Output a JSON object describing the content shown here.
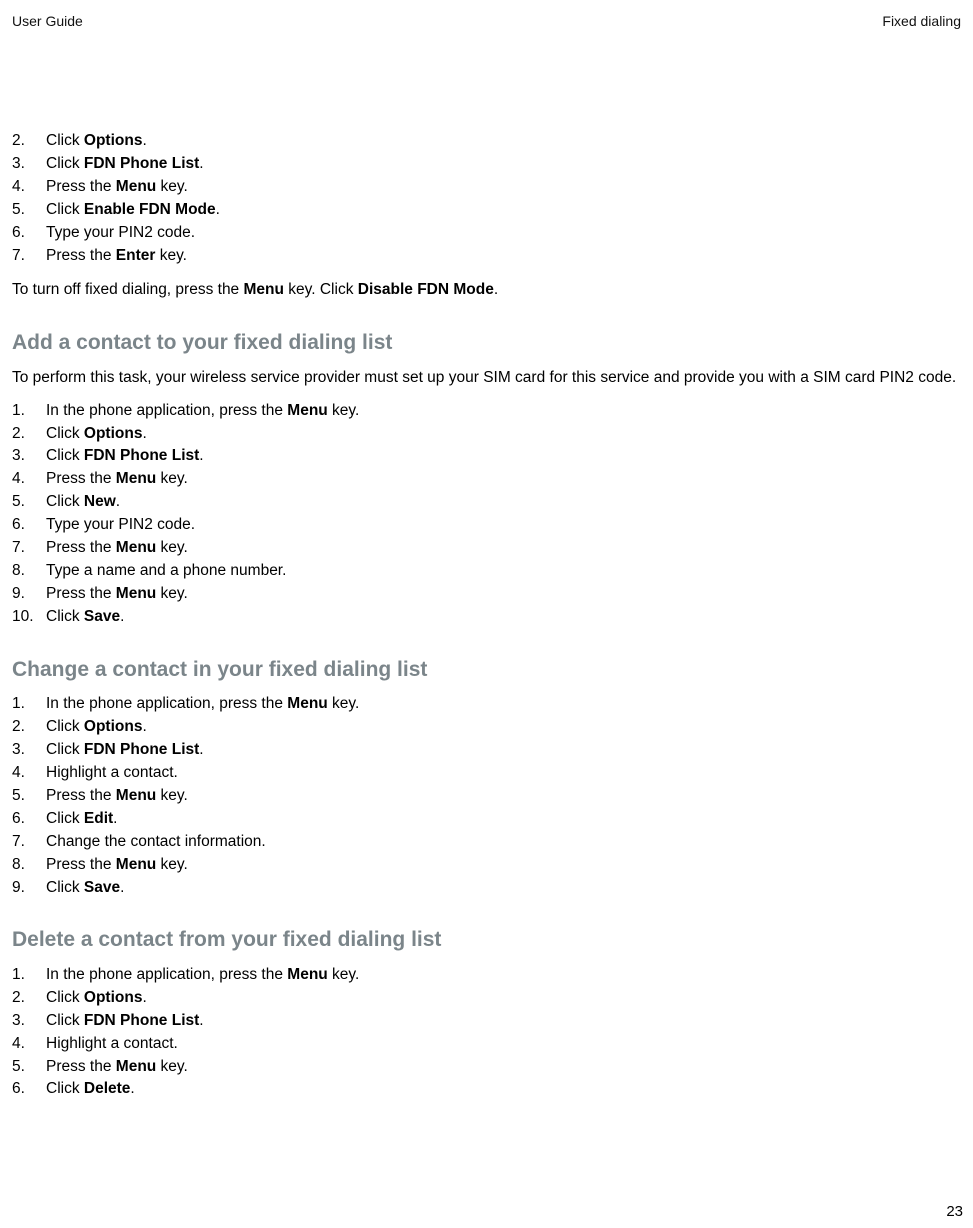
{
  "header": {
    "left": "User Guide",
    "right": "Fixed dialing"
  },
  "page_number": "23",
  "section_top": {
    "steps": [
      {
        "pre": "Click ",
        "bold": "Options",
        "post": "."
      },
      {
        "pre": "Click ",
        "bold": "FDN Phone List",
        "post": "."
      },
      {
        "pre": "Press the ",
        "bold": "Menu",
        "post": " key."
      },
      {
        "pre": "Click ",
        "bold": "Enable FDN Mode",
        "post": "."
      },
      {
        "pre": "Type your PIN2 code.",
        "bold": "",
        "post": ""
      },
      {
        "pre": "Press the ",
        "bold": "Enter",
        "post": " key."
      }
    ],
    "note": {
      "t1": "To turn off fixed dialing, press the ",
      "b1": "Menu",
      "t2": " key. Click ",
      "b2": "Disable FDN Mode",
      "t3": "."
    }
  },
  "section_add": {
    "heading": "Add a contact to your fixed dialing list",
    "intro": "To perform this task, your wireless service provider must set up your SIM card for this service and provide you with a SIM card PIN2 code.",
    "steps": [
      {
        "pre": "In the phone application, press the ",
        "bold": "Menu",
        "post": " key."
      },
      {
        "pre": "Click ",
        "bold": "Options",
        "post": "."
      },
      {
        "pre": "Click ",
        "bold": "FDN Phone List",
        "post": "."
      },
      {
        "pre": "Press the ",
        "bold": "Menu",
        "post": " key."
      },
      {
        "pre": "Click ",
        "bold": "New",
        "post": "."
      },
      {
        "pre": "Type your PIN2 code.",
        "bold": "",
        "post": ""
      },
      {
        "pre": "Press the ",
        "bold": "Menu",
        "post": " key."
      },
      {
        "pre": "Type a name and a phone number.",
        "bold": "",
        "post": ""
      },
      {
        "pre": "Press the ",
        "bold": "Menu",
        "post": " key."
      },
      {
        "pre": "Click ",
        "bold": "Save",
        "post": "."
      }
    ]
  },
  "section_change": {
    "heading": "Change a contact in your fixed dialing list",
    "steps": [
      {
        "pre": "In the phone application, press the ",
        "bold": "Menu",
        "post": " key."
      },
      {
        "pre": "Click ",
        "bold": "Options",
        "post": "."
      },
      {
        "pre": "Click ",
        "bold": "FDN Phone List",
        "post": "."
      },
      {
        "pre": "Highlight a contact.",
        "bold": "",
        "post": ""
      },
      {
        "pre": "Press the ",
        "bold": "Menu",
        "post": " key."
      },
      {
        "pre": "Click ",
        "bold": "Edit",
        "post": "."
      },
      {
        "pre": "Change the contact information.",
        "bold": "",
        "post": ""
      },
      {
        "pre": "Press the ",
        "bold": "Menu",
        "post": " key."
      },
      {
        "pre": "Click ",
        "bold": "Save",
        "post": "."
      }
    ]
  },
  "section_delete": {
    "heading": "Delete a contact from your fixed dialing list",
    "steps": [
      {
        "pre": "In the phone application, press the ",
        "bold": "Menu",
        "post": " key."
      },
      {
        "pre": "Click ",
        "bold": "Options",
        "post": "."
      },
      {
        "pre": "Click ",
        "bold": "FDN Phone List",
        "post": "."
      },
      {
        "pre": "Highlight a contact.",
        "bold": "",
        "post": ""
      },
      {
        "pre": "Press the ",
        "bold": "Menu",
        "post": " key."
      },
      {
        "pre": "Click ",
        "bold": "Delete",
        "post": "."
      }
    ]
  }
}
